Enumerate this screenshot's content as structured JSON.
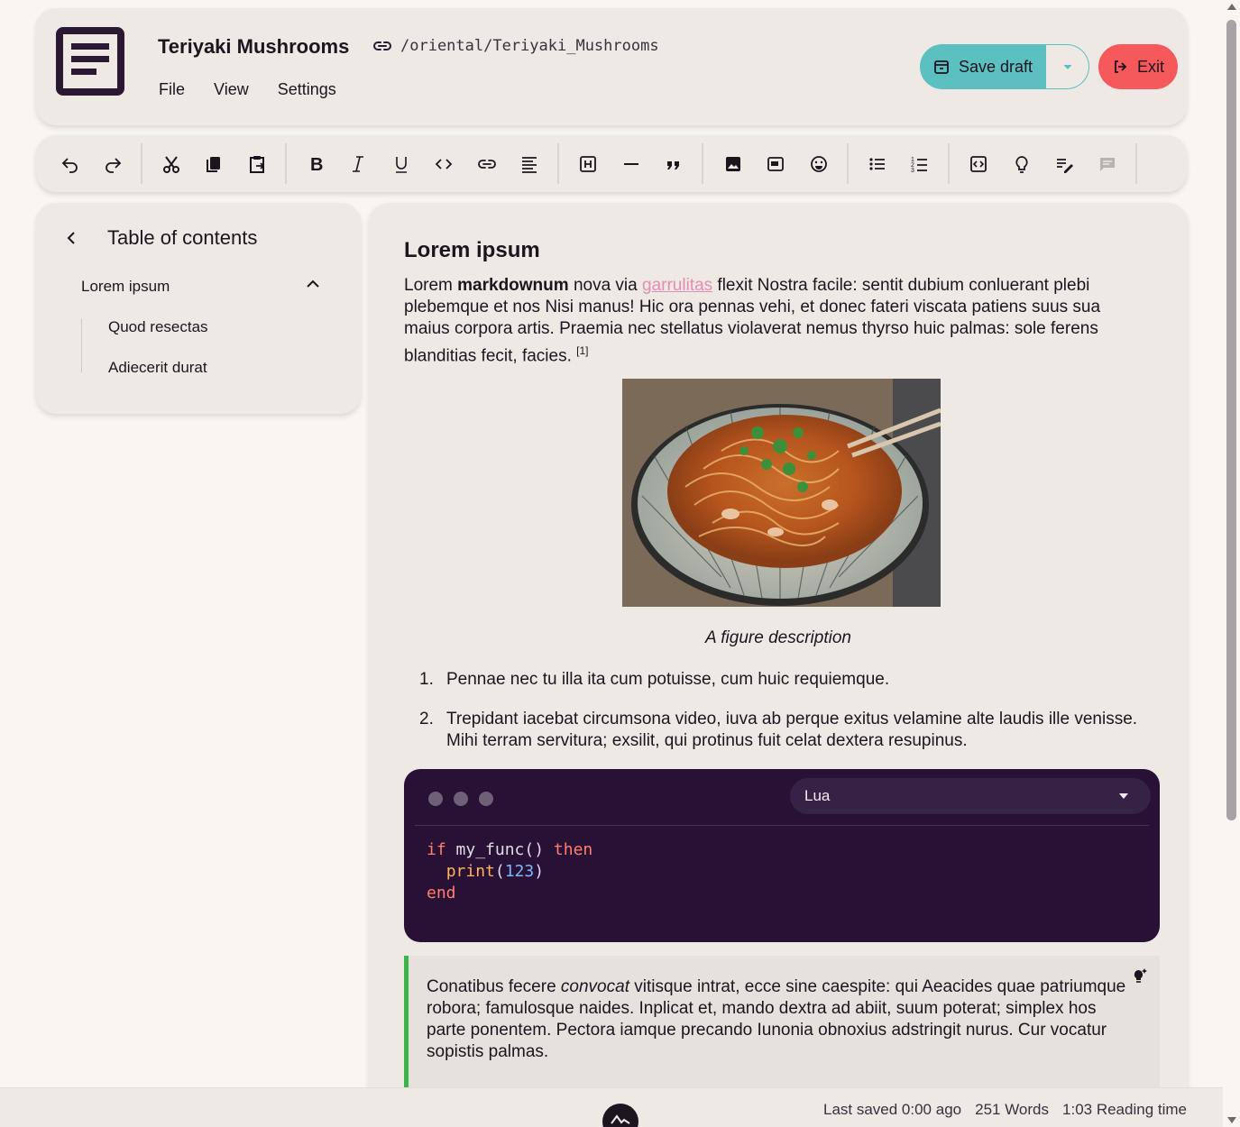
{
  "header": {
    "title": "Teriyaki Mushrooms",
    "path": "/oriental/Teriyaki_Mushrooms",
    "menu": [
      "File",
      "View",
      "Settings"
    ],
    "save_label": "Save draft",
    "exit_label": "Exit",
    "colors": {
      "save": "#5cc0c0",
      "exit": "#f5595b"
    }
  },
  "toolbar": {
    "icons": [
      "undo-icon",
      "redo-icon",
      "cut-icon",
      "copy-icon",
      "paste-icon",
      "bold-icon",
      "italic-icon",
      "underline-icon",
      "code-icon",
      "link-icon",
      "align-icon",
      "heading-icon",
      "horizontal-rule-icon",
      "quote-icon",
      "image-icon",
      "embed-icon",
      "emoji-icon",
      "bullet-list-icon",
      "ordered-list-icon",
      "code-block-icon",
      "lightbulb-icon",
      "edit-note-icon",
      "comment-icon"
    ]
  },
  "toc": {
    "title": "Table of contents",
    "items": [
      {
        "label": "Lorem ipsum"
      },
      {
        "label": "Quod resectas"
      },
      {
        "label": "Adiecerit durat"
      }
    ]
  },
  "editor": {
    "heading": "Lorem ipsum",
    "para_pre": "Lorem ",
    "para_bold": "markdownum",
    "para_mid": " nova via ",
    "para_link": "garrulitas",
    "para_post": " flexit Nostra facile: sentit dubium conluerant plebi plebemque et nos Nisi manus! Hic ora pennas vehi, et donec fateri viscata patiens suus sua maius corpora artis. Praemia nec stellatus violaverat nemus thyrso huic  palmas: sole ferens blanditias fecit, facies. ",
    "para_footnote": "[1]",
    "caption": "A figure description",
    "list": [
      {
        "num": "1.",
        "text": "Pennae nec tu illa ita cum potuisse, cum huic requiemque."
      },
      {
        "num": "2.",
        "text": "Trepidant iacebat circumsona video, iuva ab perque exitus velamine alte laudis ille venisse. Mihi terram servitura; exsilit, qui protinus fuit celat dextera resupinus."
      }
    ],
    "code": {
      "language": "Lua",
      "lines": [
        "if my_func() then",
        "  print(123)",
        "end"
      ]
    },
    "callout_pre": "Conatibus fecere ",
    "callout_em": "convocat",
    "callout_post": " vitisque intrat, ecce sine caespite: qui Aeacides quae patriumque robora; famulosque naides. Inplicat et, mando dextra ad abiit, suum poterat; simplex hos parte ponentem. Pectora iamque precando Iunonia obnoxius adstringit nurus. Cur vocatur sopistis palmas."
  },
  "status": {
    "last_saved": "Last saved 0:00 ago",
    "words": "251 Words",
    "reading_time": "1:03 Reading time"
  }
}
